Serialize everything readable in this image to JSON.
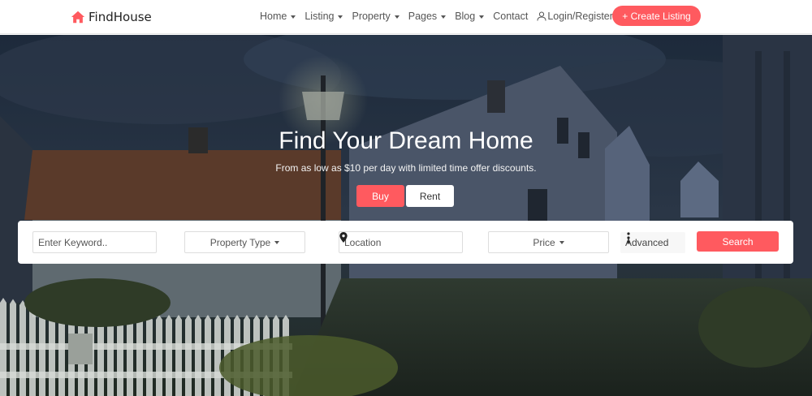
{
  "brand": {
    "name": "FindHouse",
    "icon": "home-icon",
    "accent": "#ff5a5f"
  },
  "nav": {
    "items": [
      {
        "label": "Home",
        "dropdown": true
      },
      {
        "label": "Listing",
        "dropdown": true
      },
      {
        "label": "Property",
        "dropdown": true
      },
      {
        "label": "Pages",
        "dropdown": true
      },
      {
        "label": "Blog",
        "dropdown": true
      },
      {
        "label": "Contact",
        "dropdown": false
      }
    ],
    "login_label": "Login/Register",
    "login_icon": "user-icon",
    "create_label": "+ Create Listing"
  },
  "hero": {
    "title": "Find Your Dream Home",
    "subtitle": "From as low as $10 per day with limited time offer discounts.",
    "tabs": {
      "buy": "Buy",
      "rent": "Rent"
    }
  },
  "search": {
    "keyword_placeholder": "Enter Keyword..",
    "property_type": "Property Type",
    "location_placeholder": "Location",
    "location_icon": "map-pin-icon",
    "price": "Price",
    "advanced_label": "Advanced",
    "advanced_icon": "vertical-dots-icon",
    "search_label": "Search"
  }
}
